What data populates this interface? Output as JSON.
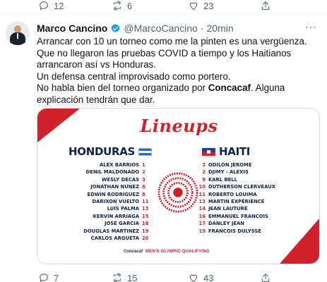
{
  "top_actions": {
    "reply_count": "12",
    "retweet_count": "6",
    "like_count": "23"
  },
  "tweet": {
    "author_name": "Marco Cancino",
    "handle": "@MarcoCancino",
    "separator": "·",
    "time": "20min",
    "more_label": "···",
    "line1": "Arrancar con 10 un torneo como me la pinten es una vergüenza.",
    "line2": "Que no llegaron las pruebas COVID a tiempo y los Haitianos arrancaron así vs Honduras.",
    "line3": "Un defensa central improvisado como portero.",
    "line4_prefix": "No habla bien del torneo organizado por ",
    "line4_mention": "Concacaf",
    "line4_suffix": ". Alguna explicación tendrán que dar."
  },
  "card": {
    "title": "Lineups",
    "team_left": "HONDURAS",
    "team_right": "HAITI",
    "honduras": [
      {
        "name": "ALEX BARRIOS",
        "num": "1"
      },
      {
        "name": "DENIL MALDONADO",
        "num": "2"
      },
      {
        "name": "WESLY DECAS",
        "num": "3"
      },
      {
        "name": "JONATHAN NUÑEZ",
        "num": "6"
      },
      {
        "name": "EDWIN RODRIGUEZ",
        "num": "8"
      },
      {
        "name": "DARIXON VUELTO",
        "num": "11"
      },
      {
        "name": "LUIS PALMA",
        "num": "13"
      },
      {
        "name": "KERVIN ARRIAGA",
        "num": "15"
      },
      {
        "name": "JOSE GARCIA",
        "num": "16"
      },
      {
        "name": "DOUGLAS MARTINEZ",
        "num": "19"
      },
      {
        "name": "CARLOS ARGUETA",
        "num": "20"
      }
    ],
    "haiti": [
      {
        "num": "3",
        "name": "ODILON JEROME"
      },
      {
        "num": "2",
        "name": "DJIMY - ALEXIS"
      },
      {
        "num": "9",
        "name": "KARL BELL"
      },
      {
        "num": "10",
        "name": "DUTHERSON CLERVEAUX"
      },
      {
        "num": "11",
        "name": "ROBERTO LOUIMA"
      },
      {
        "num": "13",
        "name": "MARTIN EXPÉRIENCE"
      },
      {
        "num": "14",
        "name": "JEAN LAUTURE"
      },
      {
        "num": "16",
        "name": "EMMANUEL FRANCOIS"
      },
      {
        "num": "17",
        "name": "DANLEY JEAN"
      },
      {
        "num": "19",
        "name": "FRANCOIS DULYSSE"
      }
    ],
    "footer_org": "Concacaf",
    "footer_event": "MEN'S OLYMPIC QUALIFYING"
  },
  "bottom_actions": {
    "reply_count": "7",
    "retweet_count": "15",
    "like_count": "43"
  },
  "colors": {
    "accent_red": "#d0212d",
    "navy": "#11214a",
    "verified_blue": "#1d9bf0",
    "muted": "#536471"
  }
}
